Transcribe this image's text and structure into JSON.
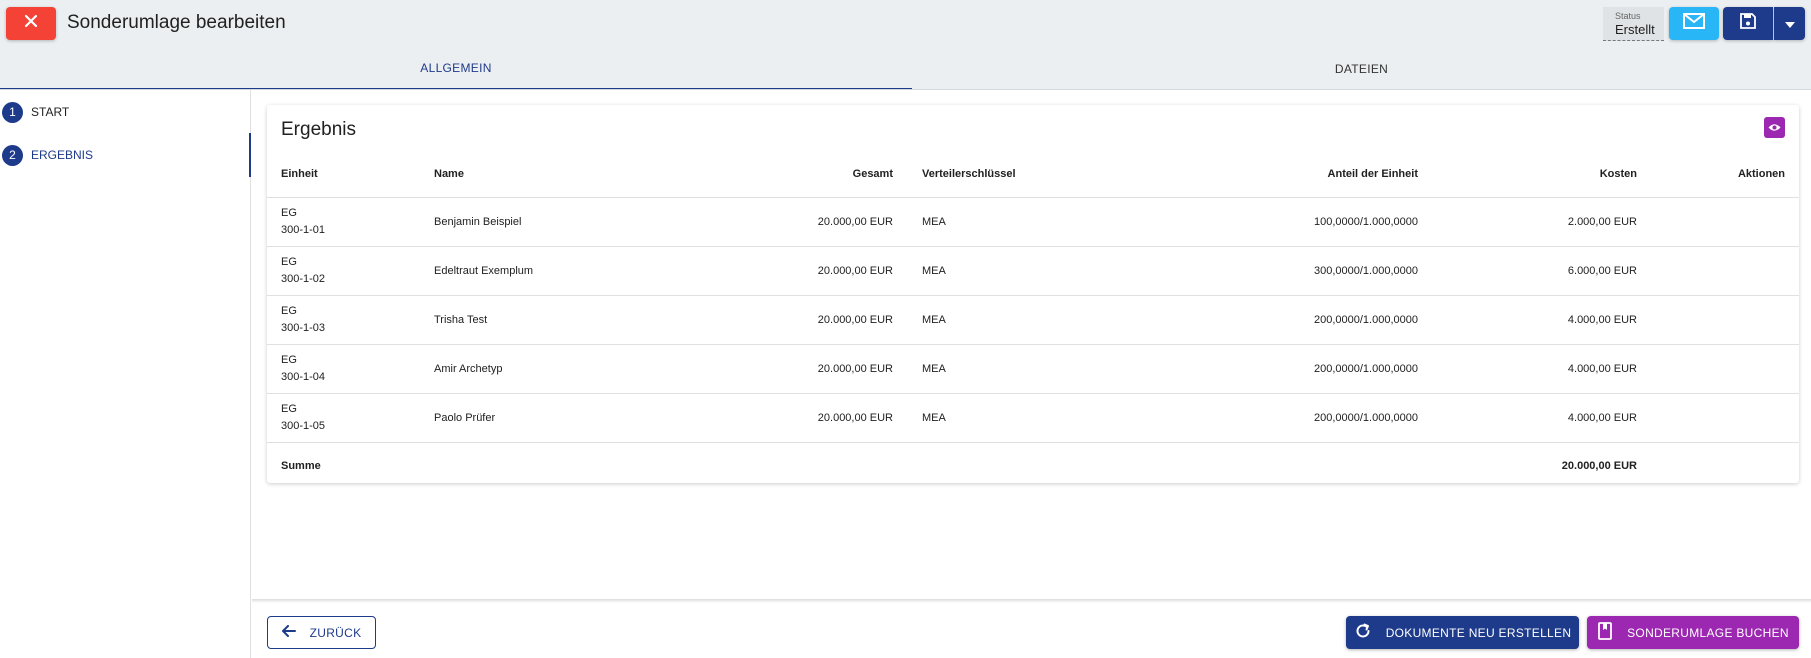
{
  "header": {
    "title": "Sonderumlage bearbeiten",
    "status_label": "Status",
    "status_value": "Erstellt",
    "icons": {
      "close": "close-icon",
      "mail": "mail-icon",
      "save": "save-icon",
      "dropdown": "chevron-down-icon"
    },
    "colors": {
      "close": "#f44336",
      "mail": "#29b6f6",
      "primary": "#1e3a8a",
      "accent": "#9c27b0"
    }
  },
  "tabs": [
    {
      "label": "ALLGEMEIN",
      "active": true
    },
    {
      "label": "DATEIEN",
      "active": false
    }
  ],
  "steps": [
    {
      "number": "1",
      "label": "START",
      "active": false
    },
    {
      "number": "2",
      "label": "ERGEBNIS",
      "active": true
    }
  ],
  "result": {
    "title": "Ergebnis",
    "columns": {
      "einheit": "Einheit",
      "name": "Name",
      "gesamt": "Gesamt",
      "schluessel": "Verteilerschlüssel",
      "anteil": "Anteil der Einheit",
      "kosten": "Kosten",
      "aktionen": "Aktionen"
    },
    "rows": [
      {
        "floor": "EG",
        "unit": "300-1-01",
        "name": "Benjamin Beispiel",
        "gesamt": "20.000,00 EUR",
        "schluessel": "MEA",
        "anteil": "100,0000/1.000,0000",
        "kosten": "2.000,00 EUR"
      },
      {
        "floor": "EG",
        "unit": "300-1-02",
        "name": "Edeltraut Exemplum",
        "gesamt": "20.000,00 EUR",
        "schluessel": "MEA",
        "anteil": "300,0000/1.000,0000",
        "kosten": "6.000,00 EUR"
      },
      {
        "floor": "EG",
        "unit": "300-1-03",
        "name": "Trisha Test",
        "gesamt": "20.000,00 EUR",
        "schluessel": "MEA",
        "anteil": "200,0000/1.000,0000",
        "kosten": "4.000,00 EUR"
      },
      {
        "floor": "EG",
        "unit": "300-1-04",
        "name": "Amir Archetyp",
        "gesamt": "20.000,00 EUR",
        "schluessel": "MEA",
        "anteil": "200,0000/1.000,0000",
        "kosten": "4.000,00 EUR"
      },
      {
        "floor": "EG",
        "unit": "300-1-05",
        "name": "Paolo Prüfer",
        "gesamt": "20.000,00 EUR",
        "schluessel": "MEA",
        "anteil": "200,0000/1.000,0000",
        "kosten": "4.000,00 EUR"
      }
    ],
    "sum_label": "Summe",
    "sum_value": "20.000,00 EUR"
  },
  "footer": {
    "back_label": "ZURÜCK",
    "regenerate_label": "DOKUMENTE NEU ERSTELLEN",
    "book_label": "SONDERUMLAGE BUCHEN"
  }
}
